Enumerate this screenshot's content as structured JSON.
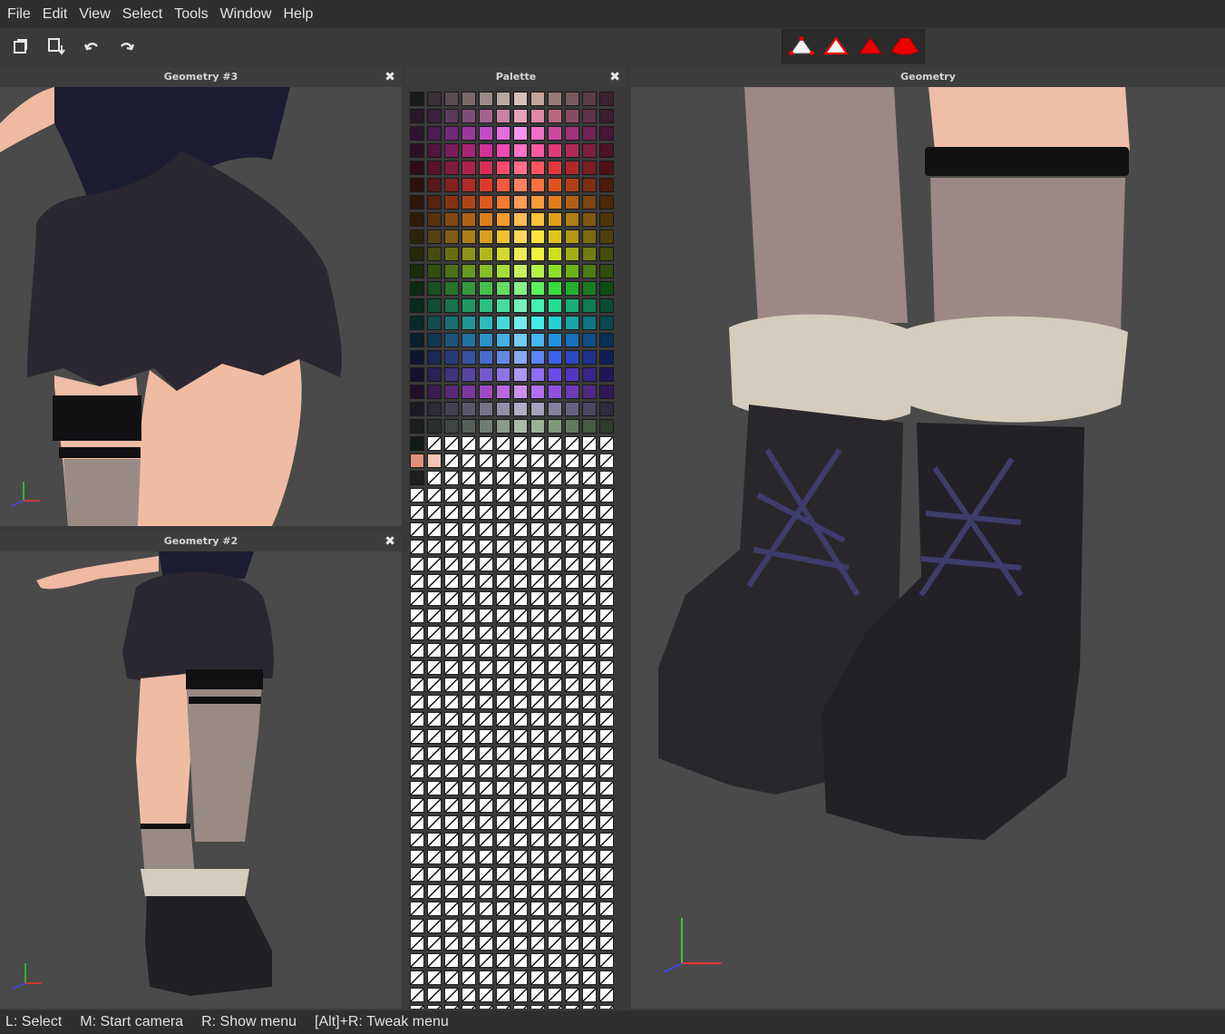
{
  "menu": {
    "items": [
      {
        "label": "File"
      },
      {
        "label": "Edit"
      },
      {
        "label": "View"
      },
      {
        "label": "Select"
      },
      {
        "label": "Tools"
      },
      {
        "label": "Window"
      },
      {
        "label": "Help"
      }
    ]
  },
  "toolbar": {
    "icons": [
      "new-window-icon",
      "open-export-icon",
      "undo-icon",
      "redo-icon"
    ],
    "selection_modes": [
      "vertex-select-icon",
      "edge-select-icon",
      "face-select-icon",
      "object-select-icon"
    ]
  },
  "panels": {
    "geometry3": {
      "title": "Geometry #3",
      "close": "✖"
    },
    "geometry2": {
      "title": "Geometry #2",
      "close": "✖"
    },
    "palette": {
      "title": "Palette",
      "close": "✖"
    },
    "geometry": {
      "title": "Geometry"
    }
  },
  "palette": {
    "rows": [
      [
        "#1a1a1a",
        "#3a3038",
        "#5a4c52",
        "#7a6a6a",
        "#9a8a88",
        "#b8a8a2",
        "#d4c0b6",
        "#c4a49a",
        "#9a7a78",
        "#7a5a5e",
        "#5a3c46",
        "#3a2230"
      ],
      [
        "#281828",
        "#3e2240",
        "#5c3a5c",
        "#7e4e74",
        "#a4648e",
        "#c884a4",
        "#e6a4ba",
        "#e088a4",
        "#b8687e",
        "#8a4c64",
        "#5e3248",
        "#3c1e30"
      ],
      [
        "#2c1430",
        "#4c1c54",
        "#722a7a",
        "#9a389e",
        "#c44cc4",
        "#e46ee0",
        "#f494ee",
        "#f070c8",
        "#d048a0",
        "#a03478",
        "#702454",
        "#461638"
      ],
      [
        "#2c1024",
        "#52163e",
        "#7c1c5a",
        "#a82478",
        "#d23096",
        "#f04ab2",
        "#ff72c4",
        "#ff5aa0",
        "#e03a78",
        "#b02a58",
        "#7c1e40",
        "#4c1228"
      ],
      [
        "#2e0e18",
        "#54142a",
        "#801a3a",
        "#ac224c",
        "#d82e5c",
        "#f44a70",
        "#ff7088",
        "#ff5460",
        "#e0383c",
        "#b0282c",
        "#7c1c20",
        "#4c1214"
      ],
      [
        "#2e1010",
        "#561818",
        "#842020",
        "#b02a26",
        "#dc3a2c",
        "#f45a40",
        "#ff8060",
        "#ff7040",
        "#e05420",
        "#b04018",
        "#7c2e12",
        "#4c1c0c"
      ],
      [
        "#2e160c",
        "#562410",
        "#843414",
        "#b04618",
        "#dc5a1c",
        "#f47a30",
        "#ff9c58",
        "#ff9a3c",
        "#e07c1c",
        "#b06014",
        "#7c4410",
        "#4c2a0a"
      ],
      [
        "#2e1c0a",
        "#563010",
        "#844814",
        "#b06218",
        "#dc7e1c",
        "#f49c30",
        "#ffba58",
        "#ffc23c",
        "#e0a01c",
        "#b07e14",
        "#7c5810",
        "#4c360a"
      ],
      [
        "#2c240a",
        "#544010",
        "#805e14",
        "#ac7e18",
        "#d8a01c",
        "#f0c030",
        "#ffd858",
        "#ffe43c",
        "#e0c41c",
        "#b09a14",
        "#7c6c10",
        "#4c420a"
      ],
      [
        "#26280a",
        "#464c10",
        "#686e14",
        "#8c9218",
        "#b2b81c",
        "#d4d830",
        "#eeec58",
        "#eef43c",
        "#cce01c",
        "#a0b014",
        "#727c10",
        "#444c0a"
      ],
      [
        "#1c2a0c",
        "#324e12",
        "#4c7218",
        "#68981e",
        "#86c026",
        "#a6dc3a",
        "#c8f060",
        "#b4f444",
        "#8ee026",
        "#6cb01a",
        "#4c7c12",
        "#2e4c0c"
      ],
      [
        "#0e2a12",
        "#1a4e20",
        "#28722e",
        "#36983c",
        "#46c04a",
        "#62dc62",
        "#88f088",
        "#5af05e",
        "#36dc3e",
        "#26b02e",
        "#1a7c22",
        "#0e4c14"
      ],
      [
        "#0a2a1c",
        "#124e34",
        "#1a724c",
        "#229866",
        "#2cc084",
        "#48dca0",
        "#72f0bc",
        "#44f0b0",
        "#24dc94",
        "#18b076",
        "#107c54",
        "#0a4c32"
      ],
      [
        "#0a2828",
        "#124c4c",
        "#1a7070",
        "#229696",
        "#2cbcbc",
        "#48d8d8",
        "#72ecec",
        "#44ecec",
        "#24d0d4",
        "#18a6ac",
        "#107680",
        "#0a4850"
      ],
      [
        "#0a1e2c",
        "#123852",
        "#1a5478",
        "#22729e",
        "#2c92c6",
        "#48b0e0",
        "#72ccf2",
        "#44b6f6",
        "#2492e6",
        "#1870bc",
        "#104e88",
        "#0a3054"
      ],
      [
        "#0e162e",
        "#1a2854",
        "#283c7c",
        "#3652a4",
        "#466ccc",
        "#628ae4",
        "#88a8f4",
        "#5c86f8",
        "#3c62e8",
        "#2c48c0",
        "#1e328c",
        "#121e58"
      ],
      [
        "#16122e",
        "#2a2254",
        "#40327c",
        "#5844a4",
        "#7258cc",
        "#8e74e4",
        "#aa96f4",
        "#8c6cf8",
        "#6c4ce8",
        "#5236c0",
        "#38248c",
        "#221658"
      ],
      [
        "#20102c",
        "#3c1c50",
        "#5a2a76",
        "#7c389c",
        "#9e4cc4",
        "#b66ade",
        "#cc90ee",
        "#b46ef2",
        "#9050e0",
        "#6e3ab8",
        "#4e2886",
        "#301854"
      ],
      [
        "#1e1a24",
        "#2e2a38",
        "#444050",
        "#5c586a",
        "#767488",
        "#9290a6",
        "#b0aec4",
        "#a4a2bc",
        "#84829e",
        "#66647e",
        "#4a4860",
        "#2e2c40"
      ],
      [
        "#1a1e1c",
        "#2a302e",
        "#3e4642",
        "#566058",
        "#6e7c72",
        "#8a9a8c",
        "#a8baa8",
        "#9cb096",
        "#809878",
        "#647a5e",
        "#485a44",
        "#2e3c2c"
      ],
      [
        "#101c14",
        null,
        null,
        null,
        null,
        null,
        null,
        null,
        null,
        null,
        null,
        null
      ],
      [
        "#e0907c",
        "#f4c4b2",
        null,
        null,
        null,
        null,
        null,
        null,
        null,
        null,
        null,
        null
      ],
      [
        "#1e1e1e",
        null,
        null,
        null,
        null,
        null,
        null,
        null,
        null,
        null,
        null,
        null
      ]
    ],
    "empty_rows": 31
  },
  "status": {
    "items": [
      {
        "label": "L: Select"
      },
      {
        "label": "M: Start camera"
      },
      {
        "label": "R: Show menu"
      },
      {
        "label": "[Alt]+R: Tweak menu"
      }
    ]
  }
}
